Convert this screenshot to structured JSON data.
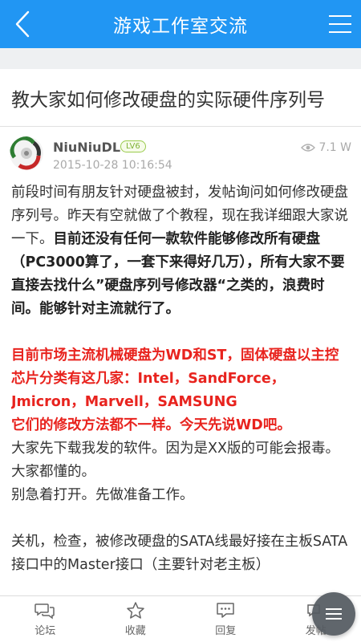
{
  "header": {
    "title": "游戏工作室交流",
    "back_icon": "chevron-left-icon",
    "menu_icon": "menu-icon"
  },
  "topic": {
    "title": "教大家如何修改硬盘的实际硬件序列号"
  },
  "post": {
    "author": "NiuNiuDL",
    "level": "LV6",
    "time": "2015-10-28 10:16:54",
    "views": "7.1 W",
    "para1_normal": "前段时间有朋友针对硬盘被封，发帖询问如何修改硬盘序列号。昨天有空就做了个教程，现在我详细跟大家说一下。",
    "para1_bold": "目前还没有任何一款软件能够修改所有硬盘（PC3000算了，一套下来得好几万），所有大家不要直接去找什么”硬盘序列号修改器“之类的，浪费时间。能够针对主流就行了。",
    "red1": "目前市场主流机械硬盘为WD和ST，固体硬盘以主控芯片分类有这几家：Intel，SandForce，Jmicron，Marvell，SAMSUNG",
    "red2": "它们的修改方法都不一样。今天先说WD吧。",
    "para3": "大家先下载我发的软件。因为是XX版的可能会报毒。大家都懂的。",
    "para4": "别急着打开。先做准备工作。",
    "para5": "关机，检查，被修改硬盘的SATA线最好接在主板SATA接口中的Master接口（主要针对老主板）"
  },
  "bottom_nav": {
    "forum": "论坛",
    "favorite": "收藏",
    "reply": "回复",
    "post": "发帖"
  },
  "colors": {
    "primary": "#2196f3",
    "red_text": "#e8231e",
    "level_green": "#7fb235"
  }
}
